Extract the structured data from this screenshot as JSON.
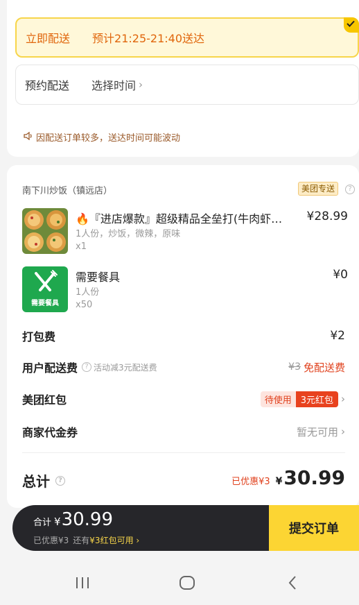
{
  "delivery": {
    "now_label": "立即配送",
    "now_eta": "预计21:25-21:40送达",
    "scheduled_label": "预约配送",
    "scheduled_value": "选择时间",
    "notice": "因配送订单较多，送达时间可能波动"
  },
  "shop": {
    "name": "南下川炒饭（镇远店）",
    "delivery_tag": "美团专送",
    "help_icon": "?"
  },
  "items": [
    {
      "name": "🔥『进店爆款』超级精品全垒打(牛肉虾仁鸡腿培根)",
      "spec": "1人份，炒饭，微辣，原味",
      "qty": "x1",
      "price": "¥28.99"
    },
    {
      "name": "需要餐具",
      "spec": "1人份",
      "qty": "x50",
      "price": "¥0",
      "thumb_text": "需要餐具"
    }
  ],
  "fees": {
    "packing_label": "打包费",
    "packing_value": "¥2",
    "delivery_label": "用户配送费",
    "delivery_note": "活动减3元配送费",
    "delivery_original": "¥3",
    "delivery_value": "免配送费",
    "redpack_label": "美团红包",
    "redpack_status": "待使用",
    "redpack_value": "3元红包",
    "voucher_label": "商家代金券",
    "voucher_value": "暂无可用"
  },
  "total": {
    "label": "总计",
    "saved": "已优惠¥3",
    "yen": "¥",
    "amount": "30.99"
  },
  "bottom_bar": {
    "sum_label": "合计",
    "yen": "¥",
    "amount": "30.99",
    "saved": "已优惠¥3",
    "redpack_prefix": "还有",
    "redpack_hint": "¥3红包可用 ›",
    "submit": "提交订单"
  },
  "colors": {
    "accent_yellow": "#fcd533",
    "orange_text": "#e0650b",
    "red": "#e0411d",
    "dark_bar": "#26262a"
  },
  "icons": [
    "check-icon",
    "speaker-icon",
    "help-icon",
    "fork-knife-icon",
    "chevron-right-icon",
    "nav-recent-icon",
    "nav-home-icon",
    "nav-back-icon"
  ]
}
